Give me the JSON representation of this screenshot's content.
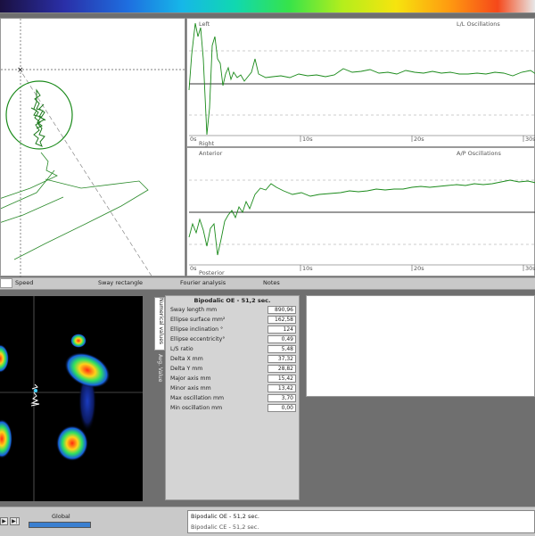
{
  "app": {
    "color_scale": "rainbow-gradient"
  },
  "lr_chart": {
    "title": "L/L Oscillations",
    "top_label": "Left",
    "bottom_label": "Right",
    "ticks": [
      "0s",
      "10s",
      "20s",
      "30s"
    ]
  },
  "ap_chart": {
    "title": "A/P Oscillations",
    "top_label": "Anterior",
    "bottom_label": "Posterior",
    "ticks": [
      "0s",
      "10s",
      "20s",
      "30s"
    ]
  },
  "tabs": [
    {
      "label": "Speed"
    },
    {
      "label": "Sway rectangle"
    },
    {
      "label": "Fourier analysis"
    },
    {
      "label": "Notes"
    }
  ],
  "side_tabs": {
    "numerical": "Numerical values",
    "avg": "Avg. Value"
  },
  "numerical": {
    "title": "Bipodalic OE - 51,2 sec.",
    "rows": [
      {
        "label": "Sway length mm",
        "value": "890,96"
      },
      {
        "label": "Ellipse surface mm²",
        "value": "162,58"
      },
      {
        "label": "Ellipse inclination °",
        "value": "124"
      },
      {
        "label": "Ellipse eccentricity°",
        "value": "0,49"
      },
      {
        "label": "L/S ratio",
        "value": "5,48"
      },
      {
        "label": "Delta X mm",
        "value": "37,32"
      },
      {
        "label": "Delta Y mm",
        "value": "28,82"
      },
      {
        "label": "Major axis mm",
        "value": "15,42"
      },
      {
        "label": "Minor axis mm",
        "value": "13,42"
      },
      {
        "label": "Max oscillation mm",
        "value": "3,70"
      },
      {
        "label": "Min oscillation mm",
        "value": "0,00"
      }
    ]
  },
  "bottom": {
    "global_label": "Global",
    "records": [
      "Bipodalic OE - 51,2 sec.",
      "Bipodalic CE - 51,2 sec."
    ],
    "nav_prev": "▶",
    "nav_next": "▶|"
  }
}
